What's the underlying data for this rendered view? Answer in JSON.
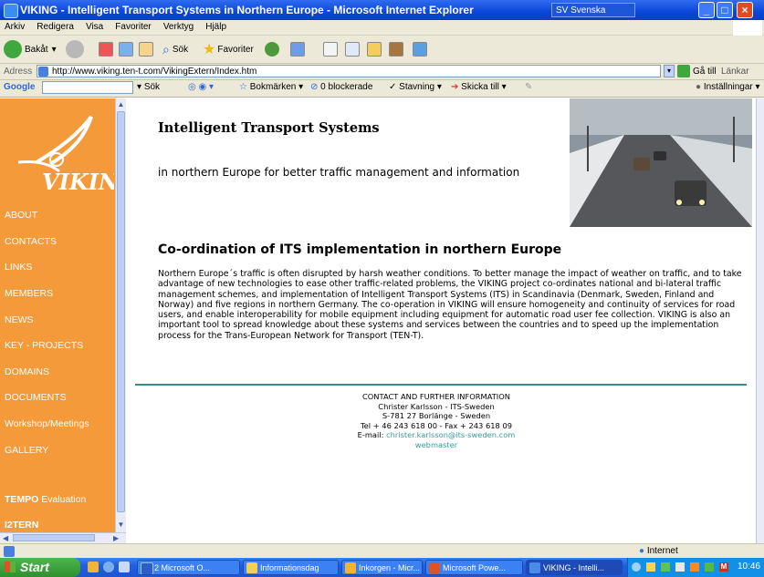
{
  "window": {
    "title": "VIKING - Intelligent Transport Systems in Northern Europe - Microsoft Internet Explorer",
    "language": "SV Svenska"
  },
  "menubar": {
    "items": [
      "Arkiv",
      "Redigera",
      "Visa",
      "Favoriter",
      "Verktyg",
      "Hjälp"
    ]
  },
  "toolbar": {
    "back": "Bakåt",
    "search": "Sök",
    "favorites": "Favoriter"
  },
  "address": {
    "label": "Adress",
    "url": "http://www.viking.ten-t.com/VikingExtern/Index.htm",
    "go": "Gå till",
    "links": "Länkar"
  },
  "googlebar": {
    "logo": "Google",
    "search": "Sök",
    "bookmarks": "Bokmärken",
    "blocked": "0 blockerade",
    "spelling": "Stavning",
    "send": "Skicka till",
    "settings": "Inställningar"
  },
  "sidebar": {
    "items": [
      {
        "label": "ABOUT"
      },
      {
        "label": "CONTACTS"
      },
      {
        "label": "LINKS"
      },
      {
        "label": "MEMBERS"
      },
      {
        "label": "NEWS"
      },
      {
        "label": "KEY - PROJECTS"
      },
      {
        "label": "DOMAINS"
      },
      {
        "label": "DOCUMENTS"
      },
      {
        "label": "Workshop/Meetings"
      },
      {
        "label": "GALLERY"
      }
    ],
    "tempo": {
      "bold": "TEMPO",
      "rest": " Evaluation"
    },
    "i2tern": "I2TERN"
  },
  "banner": {
    "title": "Intelligent Transport Systems",
    "subtitle": "in northern Europe for better traffic management and information"
  },
  "main": {
    "heading": "Co-ordination of ITS implementation in northern Europe",
    "body": "Northern Europe´s traffic is often disrupted by harsh weather conditions. To better manage the impact of weather on traffic, and to take advantage of new technologies to ease other traffic-related problems, the VIKING project co-ordinates national and bi-lateral traffic management schemes, and implementation of Intelligent Transport Systems (ITS) in Scandinavia (Denmark, Sweden, Finland and Norway) and five regions in northern Germany. The co-operation in VIKING will ensure homogeneity and continuity of services for road users, and enable interoperability for mobile equipment including equipment for automatic road user fee collection. VIKING is also an important tool to spread knowledge about these systems and services between the countries and to speed up the implementation process for the Trans-European Network for Transport (TEN-T)."
  },
  "contact": {
    "header": "CONTACT AND FURTHER INFORMATION",
    "name": "Christer Karlsson - ITS-Sweden",
    "address": "S-781 27 Borlänge - Sweden",
    "phone": "Tel + 46 243 618 00 - Fax + 243 618 09",
    "email_label": "E-mail: ",
    "email": "christer.karlsson@its-sweden.com",
    "webmaster": "webmaster"
  },
  "status": {
    "zone": "Internet"
  },
  "taskbar": {
    "start": "Start",
    "tasks": [
      {
        "label": "2 Microsoft O..."
      },
      {
        "label": "Informationsdag"
      },
      {
        "label": "Inkorgen - Micr..."
      },
      {
        "label": "Microsoft Powe..."
      },
      {
        "label": "VIKING - Intelli..."
      }
    ],
    "clock": "10:46"
  }
}
